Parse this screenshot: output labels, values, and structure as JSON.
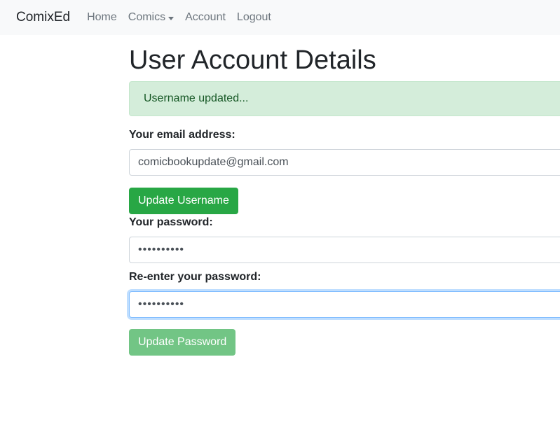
{
  "navbar": {
    "brand": "ComixEd",
    "items": [
      {
        "label": "Home"
      },
      {
        "label": "Comics"
      },
      {
        "label": "Account"
      },
      {
        "label": "Logout"
      }
    ]
  },
  "page": {
    "title": "User Account Details",
    "alert": "Username updated..."
  },
  "form": {
    "email_label": "Your email address:",
    "email_value": "comicbookupdate@gmail.com",
    "update_username_label": "Update Username",
    "password_label": "Your password:",
    "password_value": "••••••••••",
    "reenter_label": "Re-enter your password:",
    "reenter_value": "••••••••••",
    "update_password_label": "Update Password"
  },
  "colors": {
    "success": "#28a745",
    "alert_bg": "#d4edda",
    "alert_text": "#155724",
    "navbar_bg": "#f8f9fa"
  }
}
